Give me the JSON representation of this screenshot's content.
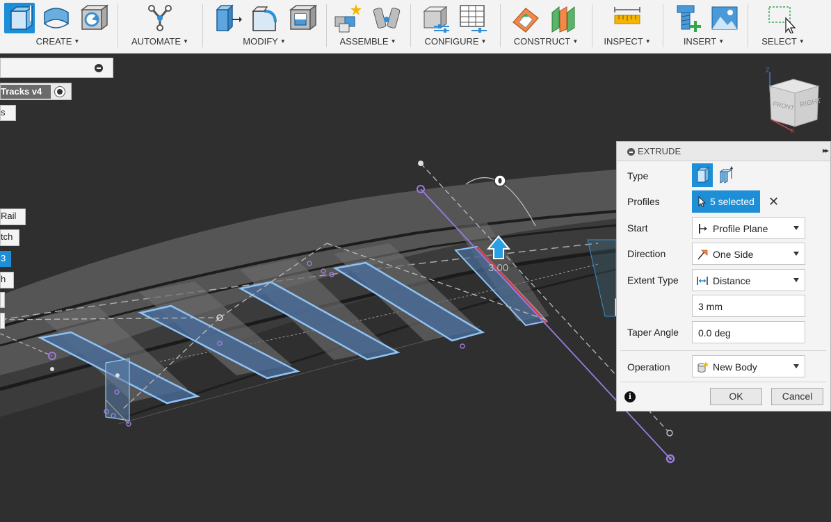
{
  "toolbar": {
    "groups": [
      {
        "label": "CREATE"
      },
      {
        "label": "AUTOMATE"
      },
      {
        "label": "MODIFY"
      },
      {
        "label": "ASSEMBLE"
      },
      {
        "label": "CONFIGURE"
      },
      {
        "label": "CONSTRUCT"
      },
      {
        "label": "INSPECT"
      },
      {
        "label": "INSERT"
      },
      {
        "label": "SELECT"
      }
    ],
    "caret": "▼",
    "icons": [
      "extrude-icon",
      "revolve-icon",
      "hole-icon",
      "automate-icon",
      "press-pull-icon",
      "fillet-icon",
      "shell-icon",
      "new-component-icon",
      "joint-icon",
      "configure-icon",
      "parameters-table-icon",
      "offset-plane-icon",
      "midplane-icon",
      "measure-icon",
      "insert-mcmaster-icon",
      "insert-canvas-icon",
      "select-window-icon"
    ]
  },
  "browser": {
    "document_name": "Tracks v4",
    "stub_items": [
      "s",
      "Rail",
      "tch",
      "3",
      "h",
      "",
      ""
    ]
  },
  "viewcube": {
    "front": "FRONT",
    "right": "RIGHT",
    "axis_z": "Z",
    "axis_x": "X"
  },
  "canvas": {
    "dimension_label": "3.00"
  },
  "extrude": {
    "title": "EXTRUDE",
    "expand_glyph": "▸▸",
    "type_label": "Type",
    "profiles_label": "Profiles",
    "profiles_value": "5 selected",
    "clear_glyph": "✕",
    "start_label": "Start",
    "start_value": "Profile Plane",
    "direction_label": "Direction",
    "direction_value": "One Side",
    "extent_label": "Extent Type",
    "extent_value": "Distance",
    "distance_value": "3 mm",
    "taper_label": "Taper Angle",
    "taper_value": "0.0 deg",
    "operation_label": "Operation",
    "operation_value": "New Body",
    "info_glyph": "i",
    "ok_label": "OK",
    "cancel_label": "Cancel"
  },
  "distance_input": {
    "value": "-3"
  },
  "colors": {
    "accent": "#1e8fd6",
    "viewport_bg": "#2f2f2f",
    "profile_fill": "#4a6c9a",
    "sketch_purple": "#9b7be0",
    "highlight_red": "#e04040"
  }
}
